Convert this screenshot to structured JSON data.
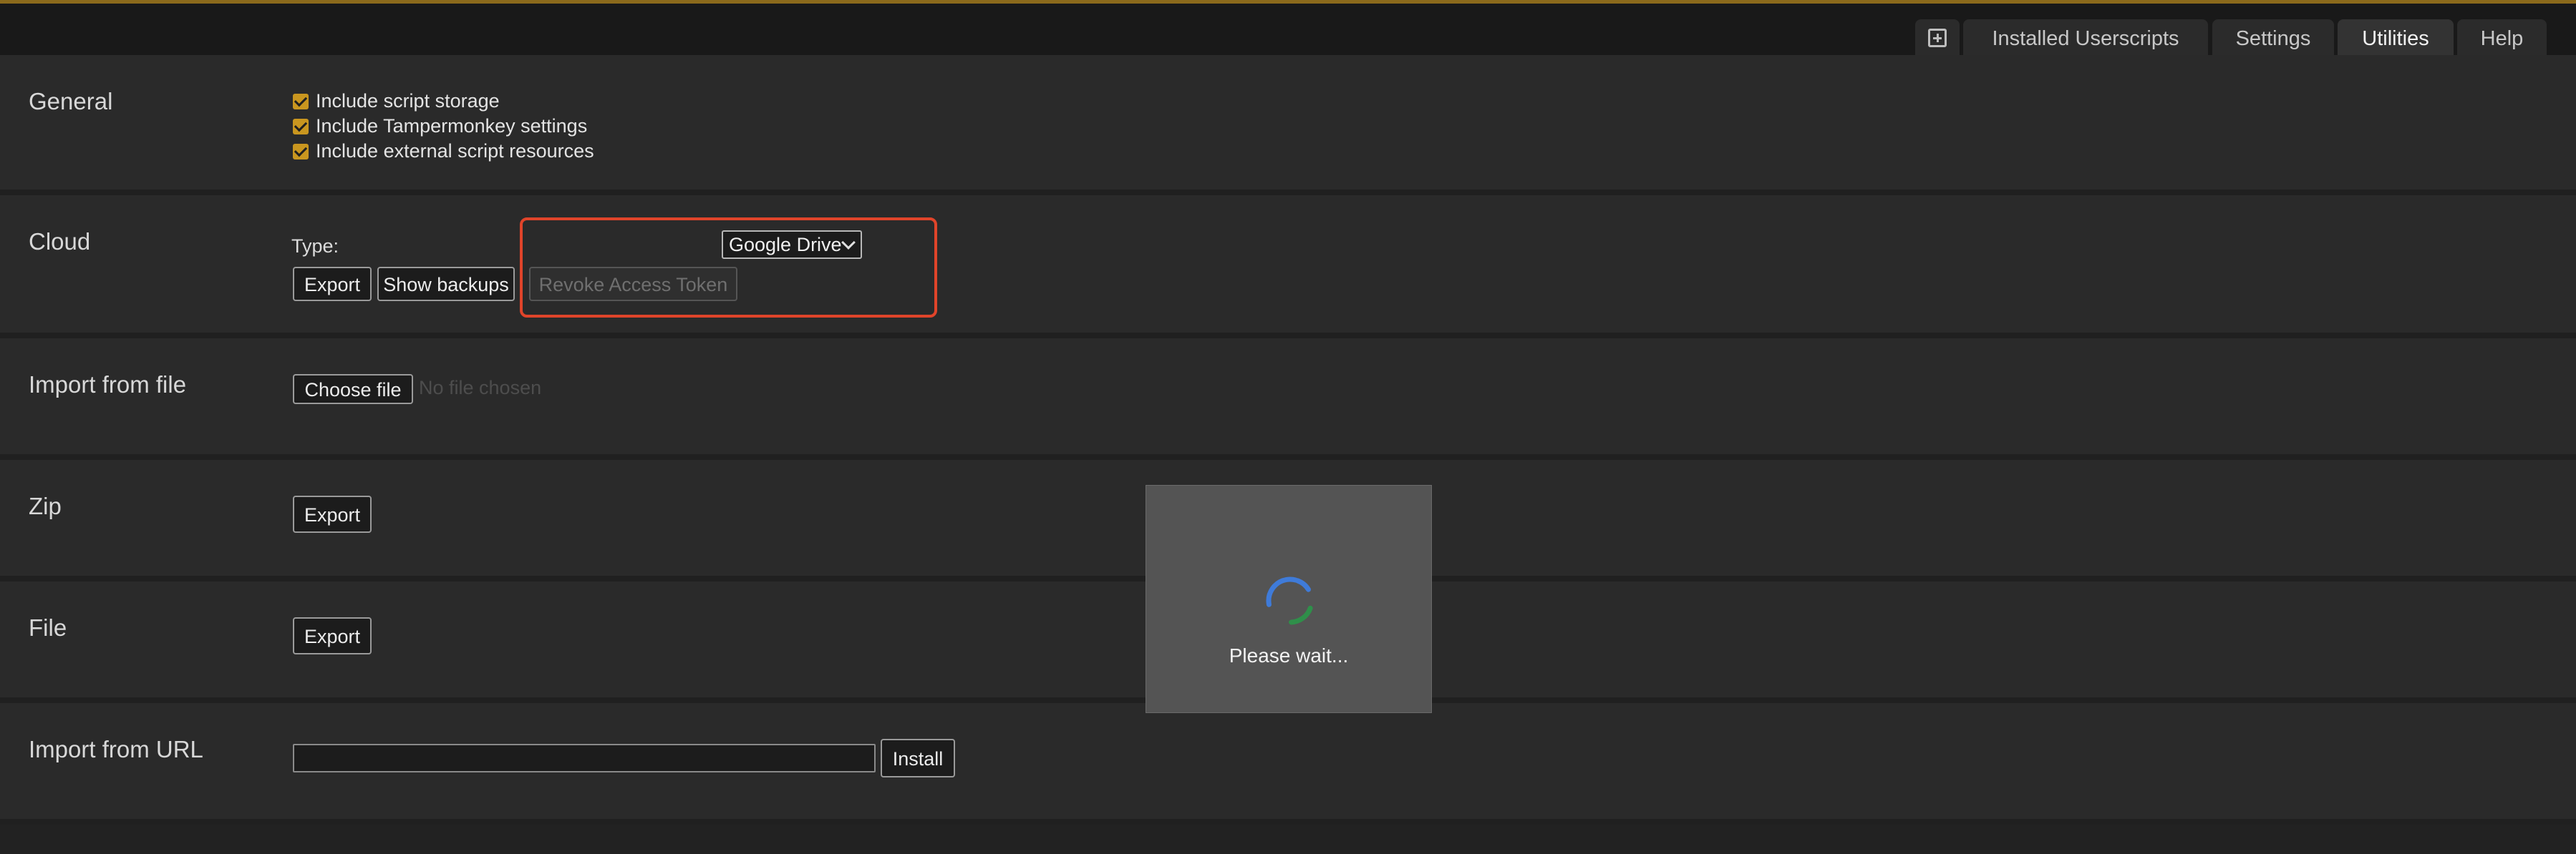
{
  "tabs": {
    "new_icon": "plus-square-icon",
    "installed": "Installed Userscripts",
    "settings": "Settings",
    "utilities": "Utilities",
    "help": "Help",
    "active": "Utilities"
  },
  "general": {
    "title": "General",
    "options": [
      {
        "label": "Include script storage",
        "checked": true
      },
      {
        "label": "Include Tampermonkey settings",
        "checked": true
      },
      {
        "label": "Include external script resources",
        "checked": true
      }
    ]
  },
  "cloud": {
    "title": "Cloud",
    "type_label": "Type:",
    "type_value": "Google Drive",
    "export_label": "Export",
    "show_backups_label": "Show backups",
    "revoke_label": "Revoke Access Token",
    "highlight_color": "#e0442a"
  },
  "import_file": {
    "title": "Import from file",
    "choose_label": "Choose file",
    "no_file_text": "No file chosen"
  },
  "zip": {
    "title": "Zip",
    "export_label": "Export"
  },
  "file": {
    "title": "File",
    "export_label": "Export"
  },
  "import_url": {
    "title": "Import from URL",
    "value": "",
    "install_label": "Install"
  },
  "modal": {
    "text": "Please wait..."
  },
  "colors": {
    "accent": "#c9961f",
    "top_line": "#8b6a1c",
    "background": "#2a2a2a"
  }
}
